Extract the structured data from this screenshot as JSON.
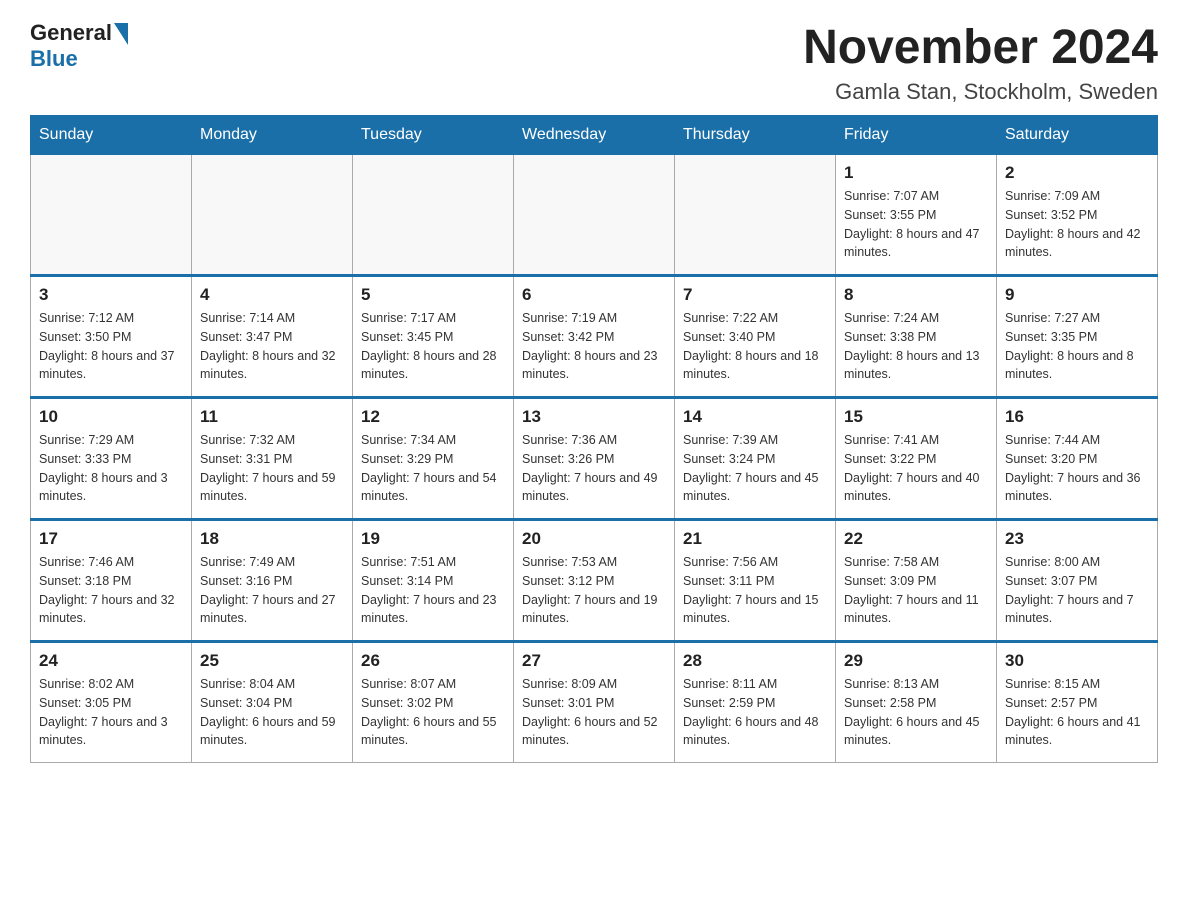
{
  "logo": {
    "text_general": "General",
    "text_blue": "Blue"
  },
  "header": {
    "month_title": "November 2024",
    "location": "Gamla Stan, Stockholm, Sweden"
  },
  "weekdays": [
    "Sunday",
    "Monday",
    "Tuesday",
    "Wednesday",
    "Thursday",
    "Friday",
    "Saturday"
  ],
  "rows": [
    [
      {
        "day": "",
        "sunrise": "",
        "sunset": "",
        "daylight": ""
      },
      {
        "day": "",
        "sunrise": "",
        "sunset": "",
        "daylight": ""
      },
      {
        "day": "",
        "sunrise": "",
        "sunset": "",
        "daylight": ""
      },
      {
        "day": "",
        "sunrise": "",
        "sunset": "",
        "daylight": ""
      },
      {
        "day": "",
        "sunrise": "",
        "sunset": "",
        "daylight": ""
      },
      {
        "day": "1",
        "sunrise": "Sunrise: 7:07 AM",
        "sunset": "Sunset: 3:55 PM",
        "daylight": "Daylight: 8 hours and 47 minutes."
      },
      {
        "day": "2",
        "sunrise": "Sunrise: 7:09 AM",
        "sunset": "Sunset: 3:52 PM",
        "daylight": "Daylight: 8 hours and 42 minutes."
      }
    ],
    [
      {
        "day": "3",
        "sunrise": "Sunrise: 7:12 AM",
        "sunset": "Sunset: 3:50 PM",
        "daylight": "Daylight: 8 hours and 37 minutes."
      },
      {
        "day": "4",
        "sunrise": "Sunrise: 7:14 AM",
        "sunset": "Sunset: 3:47 PM",
        "daylight": "Daylight: 8 hours and 32 minutes."
      },
      {
        "day": "5",
        "sunrise": "Sunrise: 7:17 AM",
        "sunset": "Sunset: 3:45 PM",
        "daylight": "Daylight: 8 hours and 28 minutes."
      },
      {
        "day": "6",
        "sunrise": "Sunrise: 7:19 AM",
        "sunset": "Sunset: 3:42 PM",
        "daylight": "Daylight: 8 hours and 23 minutes."
      },
      {
        "day": "7",
        "sunrise": "Sunrise: 7:22 AM",
        "sunset": "Sunset: 3:40 PM",
        "daylight": "Daylight: 8 hours and 18 minutes."
      },
      {
        "day": "8",
        "sunrise": "Sunrise: 7:24 AM",
        "sunset": "Sunset: 3:38 PM",
        "daylight": "Daylight: 8 hours and 13 minutes."
      },
      {
        "day": "9",
        "sunrise": "Sunrise: 7:27 AM",
        "sunset": "Sunset: 3:35 PM",
        "daylight": "Daylight: 8 hours and 8 minutes."
      }
    ],
    [
      {
        "day": "10",
        "sunrise": "Sunrise: 7:29 AM",
        "sunset": "Sunset: 3:33 PM",
        "daylight": "Daylight: 8 hours and 3 minutes."
      },
      {
        "day": "11",
        "sunrise": "Sunrise: 7:32 AM",
        "sunset": "Sunset: 3:31 PM",
        "daylight": "Daylight: 7 hours and 59 minutes."
      },
      {
        "day": "12",
        "sunrise": "Sunrise: 7:34 AM",
        "sunset": "Sunset: 3:29 PM",
        "daylight": "Daylight: 7 hours and 54 minutes."
      },
      {
        "day": "13",
        "sunrise": "Sunrise: 7:36 AM",
        "sunset": "Sunset: 3:26 PM",
        "daylight": "Daylight: 7 hours and 49 minutes."
      },
      {
        "day": "14",
        "sunrise": "Sunrise: 7:39 AM",
        "sunset": "Sunset: 3:24 PM",
        "daylight": "Daylight: 7 hours and 45 minutes."
      },
      {
        "day": "15",
        "sunrise": "Sunrise: 7:41 AM",
        "sunset": "Sunset: 3:22 PM",
        "daylight": "Daylight: 7 hours and 40 minutes."
      },
      {
        "day": "16",
        "sunrise": "Sunrise: 7:44 AM",
        "sunset": "Sunset: 3:20 PM",
        "daylight": "Daylight: 7 hours and 36 minutes."
      }
    ],
    [
      {
        "day": "17",
        "sunrise": "Sunrise: 7:46 AM",
        "sunset": "Sunset: 3:18 PM",
        "daylight": "Daylight: 7 hours and 32 minutes."
      },
      {
        "day": "18",
        "sunrise": "Sunrise: 7:49 AM",
        "sunset": "Sunset: 3:16 PM",
        "daylight": "Daylight: 7 hours and 27 minutes."
      },
      {
        "day": "19",
        "sunrise": "Sunrise: 7:51 AM",
        "sunset": "Sunset: 3:14 PM",
        "daylight": "Daylight: 7 hours and 23 minutes."
      },
      {
        "day": "20",
        "sunrise": "Sunrise: 7:53 AM",
        "sunset": "Sunset: 3:12 PM",
        "daylight": "Daylight: 7 hours and 19 minutes."
      },
      {
        "day": "21",
        "sunrise": "Sunrise: 7:56 AM",
        "sunset": "Sunset: 3:11 PM",
        "daylight": "Daylight: 7 hours and 15 minutes."
      },
      {
        "day": "22",
        "sunrise": "Sunrise: 7:58 AM",
        "sunset": "Sunset: 3:09 PM",
        "daylight": "Daylight: 7 hours and 11 minutes."
      },
      {
        "day": "23",
        "sunrise": "Sunrise: 8:00 AM",
        "sunset": "Sunset: 3:07 PM",
        "daylight": "Daylight: 7 hours and 7 minutes."
      }
    ],
    [
      {
        "day": "24",
        "sunrise": "Sunrise: 8:02 AM",
        "sunset": "Sunset: 3:05 PM",
        "daylight": "Daylight: 7 hours and 3 minutes."
      },
      {
        "day": "25",
        "sunrise": "Sunrise: 8:04 AM",
        "sunset": "Sunset: 3:04 PM",
        "daylight": "Daylight: 6 hours and 59 minutes."
      },
      {
        "day": "26",
        "sunrise": "Sunrise: 8:07 AM",
        "sunset": "Sunset: 3:02 PM",
        "daylight": "Daylight: 6 hours and 55 minutes."
      },
      {
        "day": "27",
        "sunrise": "Sunrise: 8:09 AM",
        "sunset": "Sunset: 3:01 PM",
        "daylight": "Daylight: 6 hours and 52 minutes."
      },
      {
        "day": "28",
        "sunrise": "Sunrise: 8:11 AM",
        "sunset": "Sunset: 2:59 PM",
        "daylight": "Daylight: 6 hours and 48 minutes."
      },
      {
        "day": "29",
        "sunrise": "Sunrise: 8:13 AM",
        "sunset": "Sunset: 2:58 PM",
        "daylight": "Daylight: 6 hours and 45 minutes."
      },
      {
        "day": "30",
        "sunrise": "Sunrise: 8:15 AM",
        "sunset": "Sunset: 2:57 PM",
        "daylight": "Daylight: 6 hours and 41 minutes."
      }
    ]
  ]
}
